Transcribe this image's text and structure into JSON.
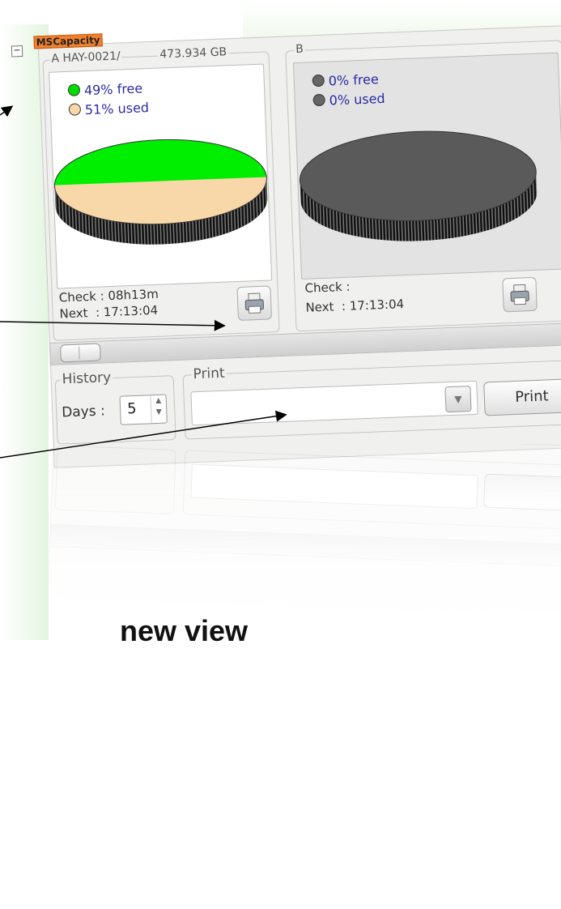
{
  "app": {
    "title": "MSCapacity"
  },
  "disk_a": {
    "group_title": "A HAY-0021/",
    "capacity": "473.934 GB",
    "legend_free": "49% free",
    "legend_used": "51% used",
    "free_percent": 49,
    "used_percent": 51,
    "check": "Check : 08h13m",
    "next": "Next  : 17:13:04",
    "colors": {
      "free": "#00ee00",
      "used": "#f8d8a8",
      "edge": "#222222"
    }
  },
  "disk_b": {
    "group_title": "B",
    "legend_free": "0% free",
    "legend_used": "0% used",
    "free_percent": 0,
    "used_percent": 0,
    "check": "Check :",
    "next": "Next  : 17:13:04",
    "colors": {
      "fill": "#5a5a5a"
    }
  },
  "history": {
    "title": "History",
    "days_label": "Days :",
    "days_value": "5"
  },
  "print": {
    "title": "Print",
    "combo_value": "",
    "button_label": "Print"
  },
  "caption": "new view",
  "icons": {
    "collapse": "minus-box-icon",
    "printer": "printer-icon",
    "spin": "spin-arrows-icon",
    "dropdown": "chevron-down-icon"
  }
}
